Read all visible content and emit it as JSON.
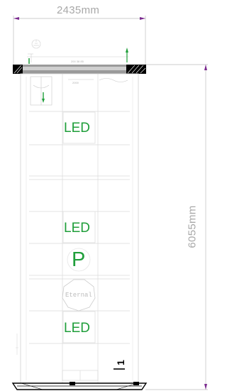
{
  "dimensions": {
    "width_label": "2435mm",
    "height_label": "6055mm"
  },
  "panels": {
    "led_label": "LED",
    "parking_label": "P",
    "brand_label": "Eternal"
  },
  "annotations": {
    "top_label": "200 38 85",
    "small_label": "2000"
  },
  "page_number": "1",
  "colors": {
    "led_green": "#1f9e3a",
    "dimension_purple": "#7b2b8f",
    "line_gray": "#d8d8d8",
    "base_black": "#000000"
  }
}
